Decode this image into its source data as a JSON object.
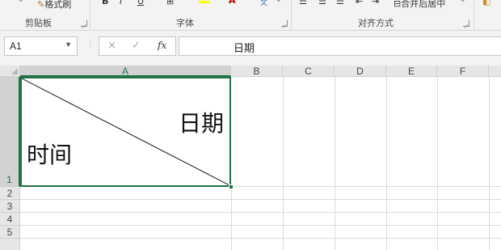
{
  "ribbon": {
    "clipboard": {
      "format_painter_label": "格式刷",
      "group_label": "剪贴板"
    },
    "font": {
      "group_label": "字体",
      "bold_label": "B",
      "italic_label": "I"
    },
    "alignment": {
      "merge_label": "合并后居中",
      "group_label": "对齐方式"
    }
  },
  "namebox": {
    "value": "A1"
  },
  "formula_bar": {
    "cancel_label": "×",
    "enter_label": "✓",
    "fx_label": "fx",
    "value": "日期"
  },
  "columns": [
    "A",
    "B",
    "C",
    "D",
    "E",
    "F"
  ],
  "rows": [
    "1",
    "2",
    "3",
    "4",
    "5"
  ],
  "selected_cell": "A1",
  "cell_a1": {
    "top_right_text": "日期",
    "bottom_left_text": "时间"
  },
  "colors": {
    "selection": "#217346",
    "ribbon_bg": "#f3f3f3"
  }
}
